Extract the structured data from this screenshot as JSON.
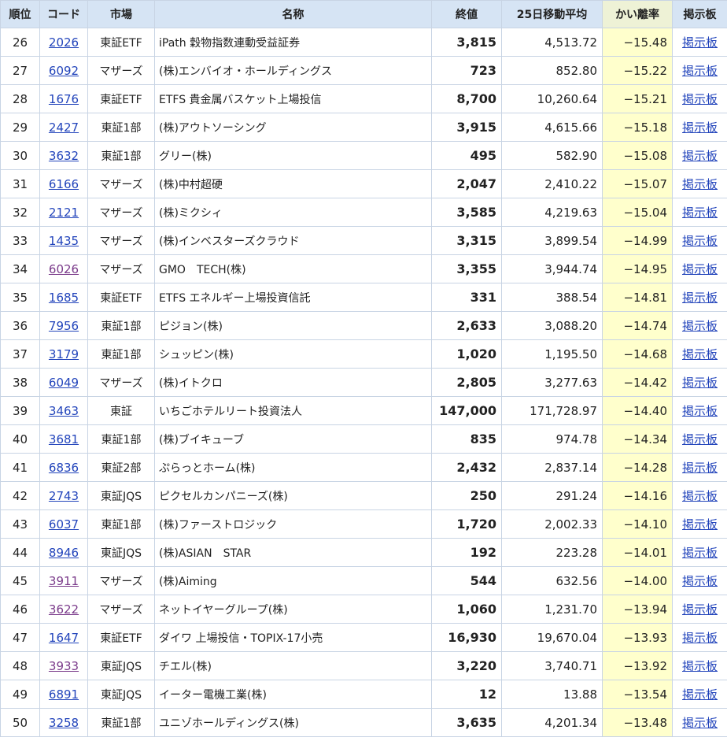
{
  "header": {
    "rank": "順位",
    "code": "コード",
    "market": "市場",
    "name": "名称",
    "close": "終値",
    "ma25": "25日移動平均",
    "deviation": "かい離率",
    "board": "掲示板"
  },
  "colors": {
    "link": "#2244bb",
    "visited_link": "#7a3a8a",
    "header_bg": "#d6e4f4",
    "deviation_bg": "#ffffcc",
    "border": "#c8d4e4"
  },
  "rows": [
    {
      "rank": "26",
      "code": "2026",
      "market": "東証ETF",
      "name": "iPath 穀物指数連動受益証券",
      "close": "3,815",
      "ma25": "4,513.72",
      "deviation": "−15.48",
      "board": "掲示板",
      "visited": false
    },
    {
      "rank": "27",
      "code": "6092",
      "market": "マザーズ",
      "name": "(株)エンバイオ・ホールディングス",
      "close": "723",
      "ma25": "852.80",
      "deviation": "−15.22",
      "board": "掲示板",
      "visited": false
    },
    {
      "rank": "28",
      "code": "1676",
      "market": "東証ETF",
      "name": "ETFS 貴金属バスケット上場投信",
      "close": "8,700",
      "ma25": "10,260.64",
      "deviation": "−15.21",
      "board": "掲示板",
      "visited": false
    },
    {
      "rank": "29",
      "code": "2427",
      "market": "東証1部",
      "name": "(株)アウトソーシング",
      "close": "3,915",
      "ma25": "4,615.66",
      "deviation": "−15.18",
      "board": "掲示板",
      "visited": false
    },
    {
      "rank": "30",
      "code": "3632",
      "market": "東証1部",
      "name": "グリー(株)",
      "close": "495",
      "ma25": "582.90",
      "deviation": "−15.08",
      "board": "掲示板",
      "visited": false
    },
    {
      "rank": "31",
      "code": "6166",
      "market": "マザーズ",
      "name": "(株)中村超硬",
      "close": "2,047",
      "ma25": "2,410.22",
      "deviation": "−15.07",
      "board": "掲示板",
      "visited": false
    },
    {
      "rank": "32",
      "code": "2121",
      "market": "マザーズ",
      "name": "(株)ミクシィ",
      "close": "3,585",
      "ma25": "4,219.63",
      "deviation": "−15.04",
      "board": "掲示板",
      "visited": false
    },
    {
      "rank": "33",
      "code": "1435",
      "market": "マザーズ",
      "name": "(株)インベスターズクラウド",
      "close": "3,315",
      "ma25": "3,899.54",
      "deviation": "−14.99",
      "board": "掲示板",
      "visited": false
    },
    {
      "rank": "34",
      "code": "6026",
      "market": "マザーズ",
      "name": "GMO　TECH(株)",
      "close": "3,355",
      "ma25": "3,944.74",
      "deviation": "−14.95",
      "board": "掲示板",
      "visited": true
    },
    {
      "rank": "35",
      "code": "1685",
      "market": "東証ETF",
      "name": "ETFS エネルギー上場投資信託",
      "close": "331",
      "ma25": "388.54",
      "deviation": "−14.81",
      "board": "掲示板",
      "visited": false
    },
    {
      "rank": "36",
      "code": "7956",
      "market": "東証1部",
      "name": "ピジョン(株)",
      "close": "2,633",
      "ma25": "3,088.20",
      "deviation": "−14.74",
      "board": "掲示板",
      "visited": false
    },
    {
      "rank": "37",
      "code": "3179",
      "market": "東証1部",
      "name": "シュッピン(株)",
      "close": "1,020",
      "ma25": "1,195.50",
      "deviation": "−14.68",
      "board": "掲示板",
      "visited": false
    },
    {
      "rank": "38",
      "code": "6049",
      "market": "マザーズ",
      "name": "(株)イトクロ",
      "close": "2,805",
      "ma25": "3,277.63",
      "deviation": "−14.42",
      "board": "掲示板",
      "visited": false
    },
    {
      "rank": "39",
      "code": "3463",
      "market": "東証",
      "name": "いちごホテルリート投資法人",
      "close": "147,000",
      "ma25": "171,728.97",
      "deviation": "−14.40",
      "board": "掲示板",
      "visited": false
    },
    {
      "rank": "40",
      "code": "3681",
      "market": "東証1部",
      "name": "(株)ブイキューブ",
      "close": "835",
      "ma25": "974.78",
      "deviation": "−14.34",
      "board": "掲示板",
      "visited": false
    },
    {
      "rank": "41",
      "code": "6836",
      "market": "東証2部",
      "name": "ぷらっとホーム(株)",
      "close": "2,432",
      "ma25": "2,837.14",
      "deviation": "−14.28",
      "board": "掲示板",
      "visited": false
    },
    {
      "rank": "42",
      "code": "2743",
      "market": "東証JQS",
      "name": "ピクセルカンパニーズ(株)",
      "close": "250",
      "ma25": "291.24",
      "deviation": "−14.16",
      "board": "掲示板",
      "visited": false
    },
    {
      "rank": "43",
      "code": "6037",
      "market": "東証1部",
      "name": "(株)ファーストロジック",
      "close": "1,720",
      "ma25": "2,002.33",
      "deviation": "−14.10",
      "board": "掲示板",
      "visited": false
    },
    {
      "rank": "44",
      "code": "8946",
      "market": "東証JQS",
      "name": "(株)ASIAN　STAR",
      "close": "192",
      "ma25": "223.28",
      "deviation": "−14.01",
      "board": "掲示板",
      "visited": false
    },
    {
      "rank": "45",
      "code": "3911",
      "market": "マザーズ",
      "name": "(株)Aiming",
      "close": "544",
      "ma25": "632.56",
      "deviation": "−14.00",
      "board": "掲示板",
      "visited": true
    },
    {
      "rank": "46",
      "code": "3622",
      "market": "マザーズ",
      "name": "ネットイヤーグループ(株)",
      "close": "1,060",
      "ma25": "1,231.70",
      "deviation": "−13.94",
      "board": "掲示板",
      "visited": true
    },
    {
      "rank": "47",
      "code": "1647",
      "market": "東証ETF",
      "name": "ダイワ 上場投信・TOPIX-17小売",
      "close": "16,930",
      "ma25": "19,670.04",
      "deviation": "−13.93",
      "board": "掲示板",
      "visited": false
    },
    {
      "rank": "48",
      "code": "3933",
      "market": "東証JQS",
      "name": "チエル(株)",
      "close": "3,220",
      "ma25": "3,740.71",
      "deviation": "−13.92",
      "board": "掲示板",
      "visited": true
    },
    {
      "rank": "49",
      "code": "6891",
      "market": "東証JQS",
      "name": "イーター電機工業(株)",
      "close": "12",
      "ma25": "13.88",
      "deviation": "−13.54",
      "board": "掲示板",
      "visited": false
    },
    {
      "rank": "50",
      "code": "3258",
      "market": "東証1部",
      "name": "ユニゾホールディングス(株)",
      "close": "3,635",
      "ma25": "4,201.34",
      "deviation": "−13.48",
      "board": "掲示板",
      "visited": false
    }
  ]
}
